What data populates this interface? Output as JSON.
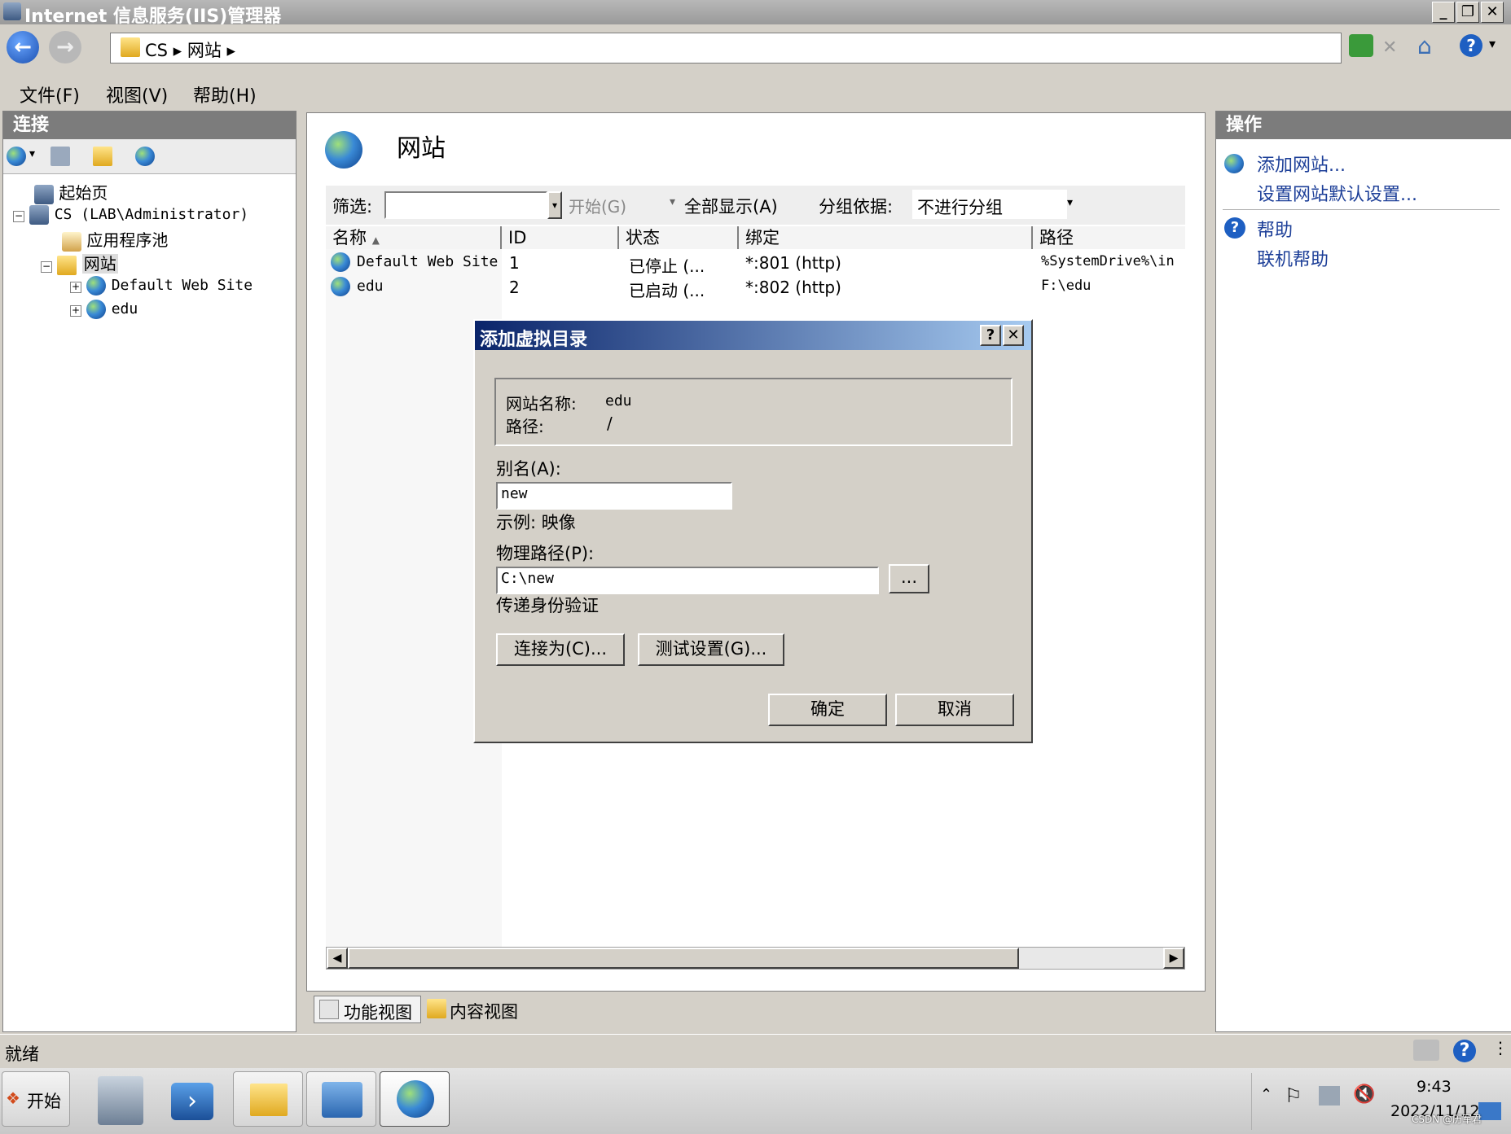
{
  "window": {
    "title": "Internet 信息服务(IIS)管理器"
  },
  "address": {
    "path": "CS ▸ 网站 ▸"
  },
  "menu": {
    "file": "文件(F)",
    "view": "视图(V)",
    "help": "帮助(H)"
  },
  "connections": {
    "header": "连接",
    "tree": {
      "start_page": "起始页",
      "server": "CS (LAB\\Administrator)",
      "app_pools": "应用程序池",
      "sites": "网站",
      "site1": "Default Web Site",
      "site2": "edu"
    }
  },
  "main": {
    "title": "网站",
    "filter": {
      "label": "筛选:",
      "start": "开始(G)",
      "show_all": "全部显示(A)",
      "group_label": "分组依据:",
      "group_value": "不进行分组"
    },
    "columns": [
      "名称",
      "ID",
      "状态",
      "绑定",
      "路径"
    ],
    "rows": [
      {
        "name": "Default Web Site",
        "id": "1",
        "status": "已停止 (...",
        "binding": "*:801 (http)",
        "path": "%SystemDrive%\\in"
      },
      {
        "name": "edu",
        "id": "2",
        "status": "已启动 (...",
        "binding": "*:802 (http)",
        "path": "F:\\edu"
      }
    ],
    "views": {
      "features": "功能视图",
      "content": "内容视图"
    }
  },
  "actions": {
    "header": "操作",
    "add_site": "添加网站...",
    "set_defaults": "设置网站默认设置...",
    "help": "帮助",
    "online_help": "联机帮助"
  },
  "dialog": {
    "title": "添加虚拟目录",
    "site_name_label": "网站名称:",
    "site_name": "edu",
    "path_label": "路径:",
    "path": "/",
    "alias_label": "别名(A):",
    "alias_value": "new",
    "example": "示例: 映像",
    "physical_label": "物理路径(P):",
    "physical_value": "C:\\new",
    "browse": "...",
    "passthrough": "传递身份验证",
    "connect_as": "连接为(C)...",
    "test_settings": "测试设置(G)...",
    "ok": "确定",
    "cancel": "取消",
    "help_btn": "?",
    "close_btn": "✕"
  },
  "status": {
    "text": "就绪"
  },
  "taskbar": {
    "start": "开始",
    "time": "9:43",
    "date": "2022/11/12",
    "watermark": "CSDN @历军君"
  },
  "colors": {
    "dialog_title_start": "#0a246a",
    "dialog_title_end": "#a6caf0",
    "link": "#1d3f98",
    "panel_header": "#7c7c7c"
  }
}
